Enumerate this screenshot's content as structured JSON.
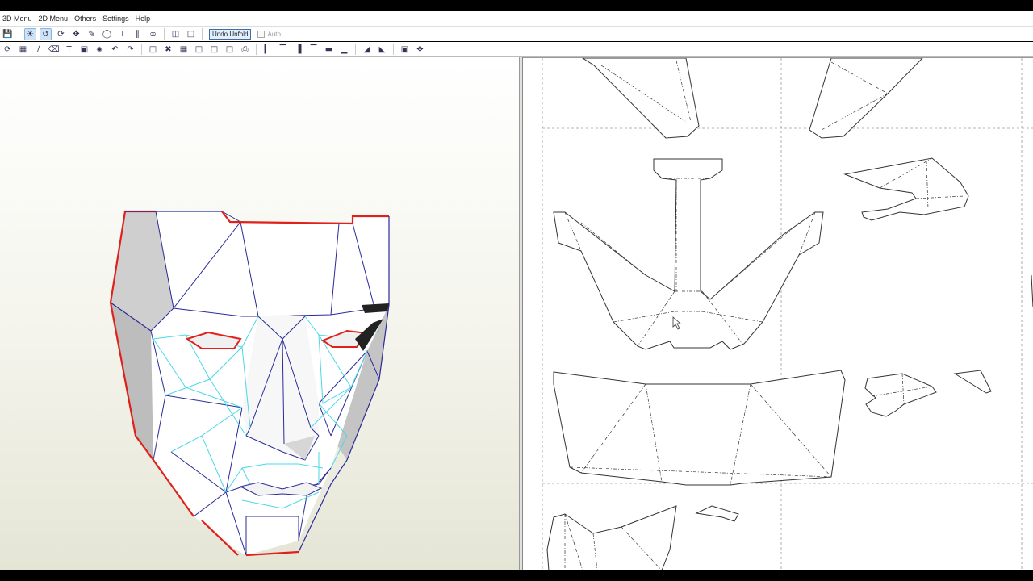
{
  "menu": {
    "items": [
      "3D Menu",
      "2D Menu",
      "Others",
      "Settings",
      "Help"
    ]
  },
  "toolbar": {
    "undo_unfold_label": "Undo Unfold",
    "auto_label": "Auto"
  },
  "icons": {
    "row1": [
      "save-icon",
      "select-icon",
      "unfold-icon",
      "rotate-icon",
      "move-icon",
      "paint-icon",
      "cylinder-icon",
      "axis-icon",
      "flip-icon",
      "link-icon",
      "layout-single-icon",
      "layout-split-icon"
    ],
    "row2": [
      "rotate-2d-icon",
      "grid-icon",
      "line-icon",
      "erase-icon",
      "text-icon",
      "image-icon",
      "cube-icon",
      "undo-icon",
      "redo-icon",
      "pages-icon",
      "fit-icon",
      "join-icon",
      "page-icon",
      "page-copy-icon",
      "page-settings-icon",
      "print-icon",
      "align-left-icon",
      "align-center-icon",
      "align-right-icon",
      "align-top-icon",
      "align-middle-icon",
      "align-bottom-icon",
      "scale-icon",
      "flip-2d-icon",
      "crop-icon",
      "expand-icon"
    ]
  },
  "colors": {
    "cut_edge": "#e0201a",
    "fold_edge": "#2a2a9a",
    "mesh_line": "#4ad8e8",
    "canvas_bg": "#f4f4ec"
  }
}
